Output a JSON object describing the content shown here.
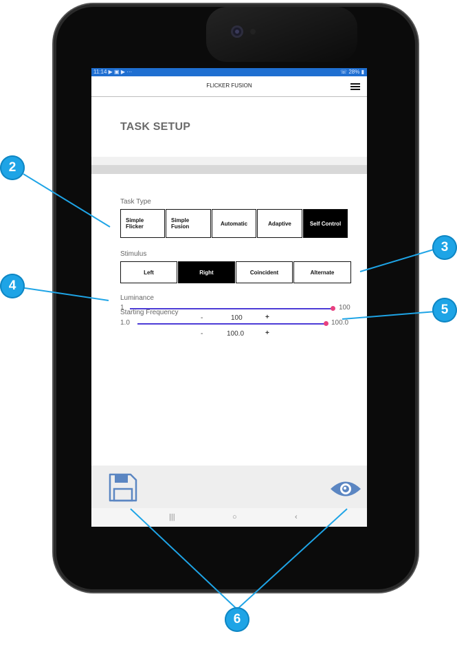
{
  "statusbar": {
    "time": "11:14",
    "indicators": "▶ ▣ ▶ ···",
    "battery": "☏ 28% ▮"
  },
  "header": {
    "title": "FLICKER FUSION",
    "menu_icon": "hamburger-menu-icon"
  },
  "page": {
    "title": "TASK SETUP"
  },
  "task_type": {
    "label": "Task Type",
    "options": [
      "Simple\nFlicker",
      "Simple\nFusion",
      "Automatic",
      "Adaptive",
      "Self Control"
    ],
    "selected": "Self Control"
  },
  "stimulus": {
    "label": "Stimulus",
    "options": [
      "Left",
      "Right",
      "Coincident",
      "Alternate"
    ],
    "selected": "Right"
  },
  "luminance": {
    "label": "Luminance",
    "min": "1",
    "max": "100",
    "value": "100",
    "minus": "-",
    "plus": "+",
    "level": 1.0
  },
  "starting_frequency": {
    "label": "Starting Frequency",
    "min": "1.0",
    "max": "100.0",
    "value": "100.0",
    "minus": "-",
    "plus": "+",
    "level": 1.0
  },
  "navbar": {
    "recents": "|||",
    "home": "○",
    "back": "‹"
  },
  "callouts": [
    "2",
    "3",
    "4",
    "5",
    "6"
  ],
  "colors": {
    "statusbar": "#1f6fd1",
    "accent_track": "#4b3bd6",
    "thumb": "#e8407f",
    "callout": "#1ea4e6",
    "icon": "#5b86c2"
  }
}
